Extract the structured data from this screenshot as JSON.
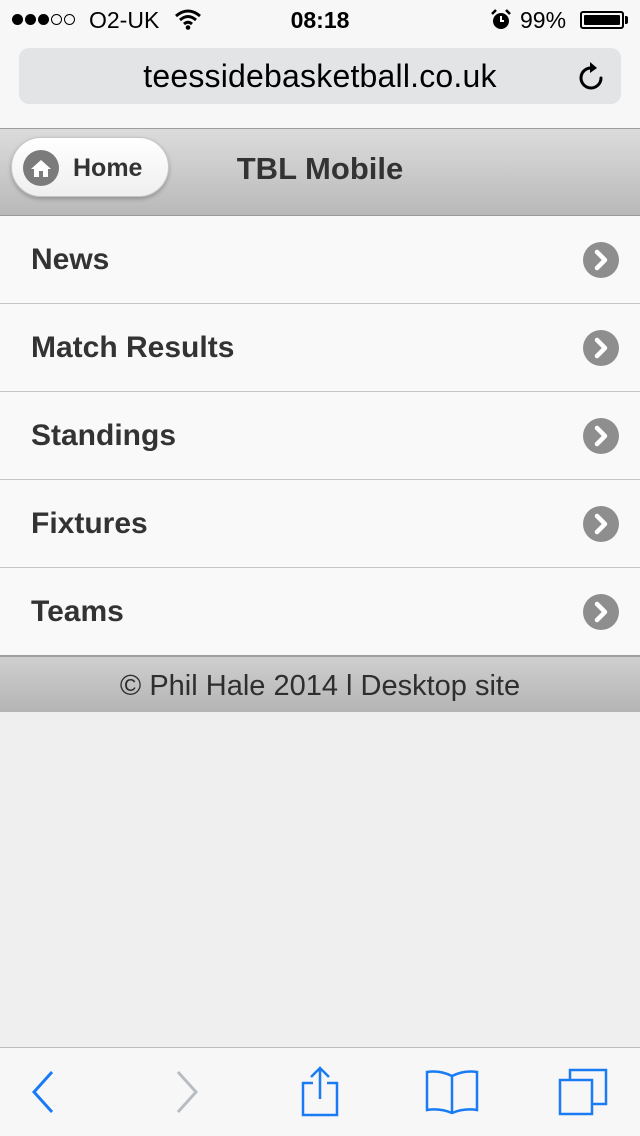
{
  "status_bar": {
    "carrier": "O2-UK",
    "time": "08:18",
    "battery": "99%",
    "signal_bars_filled": 3,
    "signal_bars_total": 5,
    "battery_level": 0.99
  },
  "browser": {
    "url": "teessidebasketball.co.uk",
    "accent_color": "#1a7cf5"
  },
  "header": {
    "home_label": "Home",
    "title": "TBL Mobile"
  },
  "nav": {
    "items": [
      {
        "label": "News"
      },
      {
        "label": "Match Results"
      },
      {
        "label": "Standings"
      },
      {
        "label": "Fixtures"
      },
      {
        "label": "Teams"
      }
    ]
  },
  "footer": {
    "text": "© Phil Hale 2014 l Desktop site"
  },
  "toolbar": {
    "icons": [
      "back-icon",
      "forward-icon",
      "share-icon",
      "bookmarks-icon",
      "tabs-icon"
    ]
  }
}
